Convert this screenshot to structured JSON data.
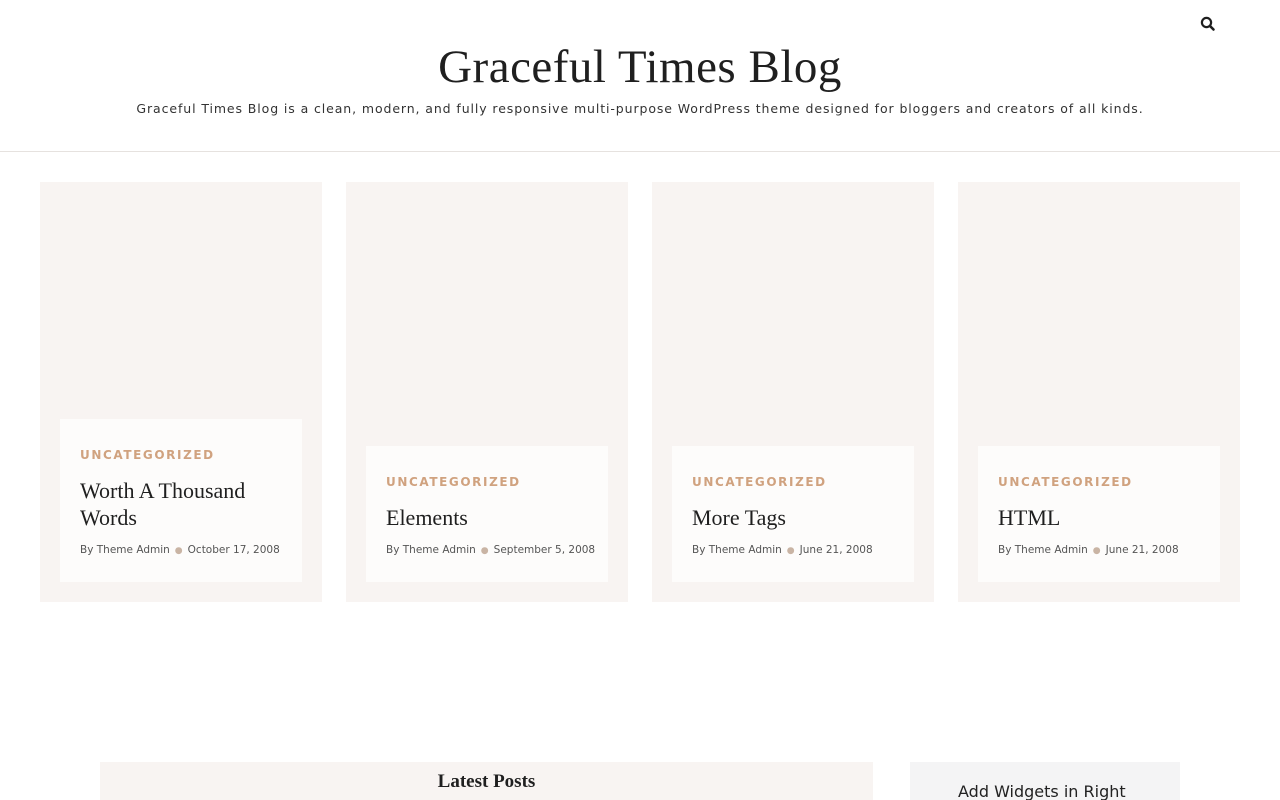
{
  "header": {
    "site_title": "Graceful Times Blog",
    "site_description": "Graceful Times Blog is a clean, modern, and fully responsive multi-purpose WordPress theme designed for bloggers and creators of all kinds.",
    "search_icon": "search-icon"
  },
  "posts": [
    {
      "category": "UNCATEGORIZED",
      "title": "Worth A Thousand Words",
      "author_prefix": "By",
      "author": "Theme Admin",
      "date": "October 17, 2008"
    },
    {
      "category": "UNCATEGORIZED",
      "title": "Elements",
      "author_prefix": "By",
      "author": "Theme Admin",
      "date": "September 5, 2008"
    },
    {
      "category": "UNCATEGORIZED",
      "title": "More Tags",
      "author_prefix": "By",
      "author": "Theme Admin",
      "date": "June 21, 2008"
    },
    {
      "category": "UNCATEGORIZED",
      "title": "HTML",
      "author_prefix": "By",
      "author": "Theme Admin",
      "date": "June 21, 2008"
    }
  ],
  "latest_section": {
    "title": "Latest Posts"
  },
  "sidebar_widget": {
    "title": "Add Widgets in Right"
  },
  "colors": {
    "accent": "#d0a27f",
    "card_bg": "#f8f4f2",
    "card_body_bg": "#fdfcfb"
  }
}
